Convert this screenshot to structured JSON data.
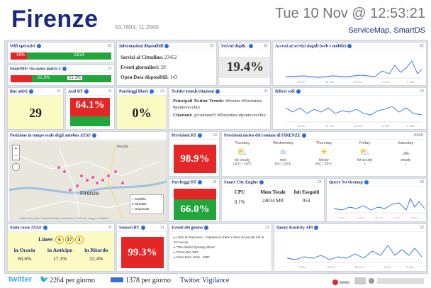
{
  "header": {
    "title": "Firenze",
    "coords": "43.7693; 11.2560",
    "datetime": "Tue 10 Nov @ 12:53:21",
    "subtitle": "ServiceMap, SmartDS"
  },
  "wifi": {
    "title": "Wifi operativi",
    "num": "21",
    "bar_left": "16%",
    "bar_right": "23/24",
    "level": 0.16
  },
  "smartds": {
    "title": "SmartDS: via santa marta 3",
    "num": "21",
    "bar_left": "21.3%",
    "bar_right": "21.3%",
    "level": 0.213
  },
  "info": {
    "title": "Informazioni disponibili",
    "num": "21",
    "lines": [
      {
        "label": "Servizi al Cittadino:",
        "value": "23452"
      },
      {
        "label": "Eventi giornalieri:",
        "value": "29"
      },
      {
        "label": "Open Data disponibili:",
        "value": "143"
      }
    ]
  },
  "dupl": {
    "title": "Servizi duplic.",
    "num": "21",
    "value": "19.4%"
  },
  "accessi": {
    "title": "Accessi ai servizi singoli (web e mobile)",
    "num": "21",
    "ticks": [
      "12 Oct",
      "19. Oct",
      "26. Oct",
      "2. Nov",
      "9. Nov"
    ]
  },
  "bus": {
    "title": "Bus attivi",
    "num": "21",
    "value": "29"
  },
  "atafrt": {
    "title": "Ataf RT",
    "num": "21",
    "value": "64.1%",
    "level": 0.641
  },
  "parcheggi": {
    "title": "Parcheggi liberi",
    "num": "22",
    "value": "0%"
  },
  "twitter": {
    "title": "Twitter trends/citazioni",
    "num": "21",
    "trends_label": "Principali Twitter Trends:",
    "trends": "#firenze #florentina #pontevecchio",
    "cit_label": "Citazioni:",
    "cit": "@comuneFi #florentina #pontevecchio"
  },
  "wifi_rilievi": {
    "title": "Rilievi wifi",
    "num": "22",
    "ticks": [
      "12 Oct",
      "19. Oct",
      "26. Oct",
      "2. Nov",
      "9. Nov"
    ]
  },
  "bus_pos": {
    "title": "Posizione in tempo reale degli autobus ATAF",
    "city": "Firenze",
    "fiesole": "Fiesole",
    "legend": [
      "Satellite",
      "Stradale",
      "Grayscale"
    ],
    "attrib": "Leaflet | Map data © OpenStreetMap contributors, CC-BY-SA, Imagery © Mapbox"
  },
  "previsioni": {
    "title": "Previsioni RT",
    "num": "22",
    "value": "98.9%"
  },
  "meteo": {
    "title": "Previsioni meteo del comune di FIRENZE",
    "num": "29991",
    "days": [
      {
        "day": "Tuesday",
        "desc": "bit cloudy",
        "temp": "13°C / 19°C",
        "icon": "partly-cloudy-icon"
      },
      {
        "day": "Wednesday",
        "desc": "mist",
        "temp": "9°C / 20°C",
        "icon": "mist-icon"
      },
      {
        "day": "Thursday",
        "desc": "bleary",
        "temp": "8°C / 20°C",
        "icon": "sun-icon"
      },
      {
        "day": "Friday",
        "desc": "bit cloudy",
        "temp": "/",
        "icon": "partly-cloudy-icon"
      },
      {
        "day": "Saturday",
        "desc": "cloudy",
        "temp": "/",
        "icon": "cloud-icon"
      }
    ]
  },
  "parcheggi_rt": {
    "title": "Parcheggi RT",
    "num": "21",
    "value": "66.0%",
    "level": 0.66
  },
  "smartcity": {
    "title": "Smart City Engine",
    "num": "21",
    "headers": [
      "CPU",
      "Mem Totale",
      "Job Eseguiti"
    ],
    "values": [
      "0.1%",
      "24034 MB",
      "954"
    ]
  },
  "servicemap": {
    "title": "Query Servicemap",
    "num": "22",
    "ticks": [
      "12 Oct",
      "19. Oct",
      "26. Oct",
      "2. Nov",
      "9. Nov"
    ]
  },
  "stato": {
    "title": "Stato corse ATAF",
    "num": "21",
    "linee_label": "Linee:",
    "linee": [
      "6",
      "17",
      "4"
    ],
    "cols": [
      {
        "label": "in Orario",
        "value": "60.6%"
      },
      {
        "label": "in Anticipo",
        "value": "17.1%"
      },
      {
        "label": "in Ritardo",
        "value": "22.4%"
      }
    ]
  },
  "sensori": {
    "title": "Sensori RT",
    "num": "21",
    "value": "99.3%"
  },
  "eventi": {
    "title": "Eventi del giorno",
    "num": "22",
    "items": [
      "L'arte di Francesco - Capolavori d'arte e terre d'Asia dal XIII al XV secolo",
      "\"The Medici Dynasty Show\"",
      "TOSCANA '900",
      "Carlo Dolci 1616 - 1687"
    ]
  },
  "km4city": {
    "title": "Query Km4city API",
    "num": "22",
    "ticks": [
      "12 Oct",
      "19. Oct",
      "26. Oct",
      "2. Nov",
      "9. Nov"
    ]
  },
  "footer": {
    "twitter_brand": "twitter",
    "per_giorno_1": "2264 per giorno",
    "per_giorno_2": "1378 per giorno",
    "vigilance": "Twitter Vigilance"
  },
  "colors": {
    "navy": "#1b2a78",
    "red": "#e52626",
    "green": "#22a63b",
    "yellow": "#fdfbc4",
    "blue_line": "#2f6ed8"
  }
}
